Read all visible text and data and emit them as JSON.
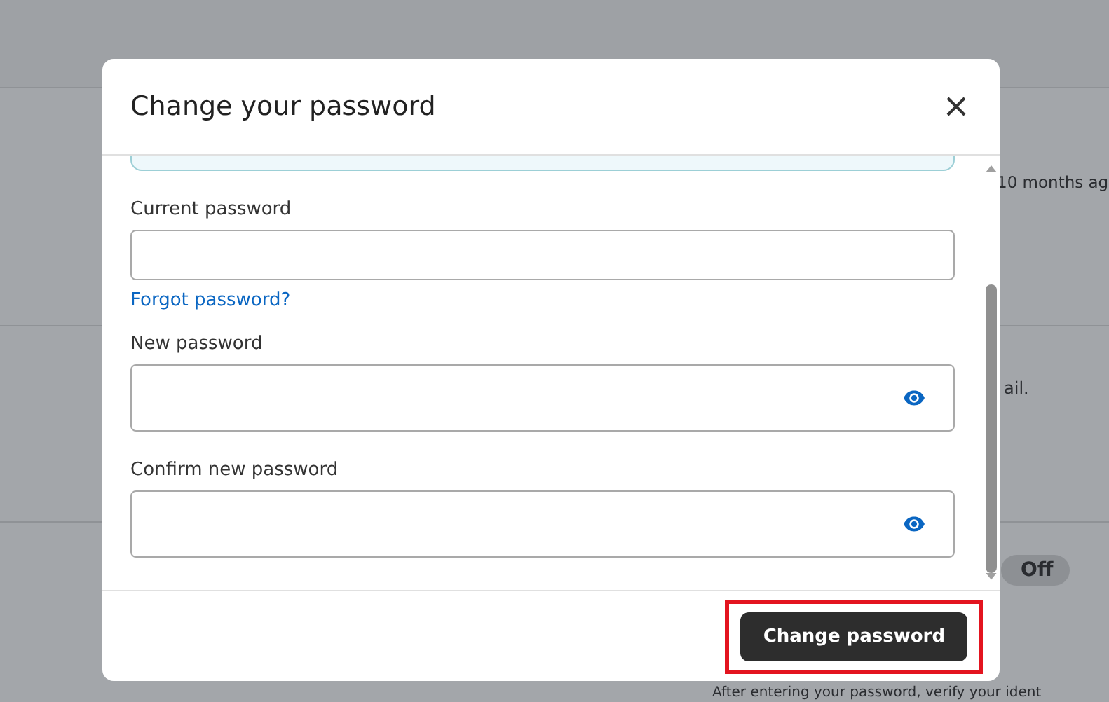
{
  "background": {
    "texts": [
      {
        "kind": "line",
        "text": "10 months ag"
      },
      {
        "kind": "line",
        "text": "ail."
      },
      {
        "kind": "pill",
        "text": "Off"
      },
      {
        "kind": "line",
        "text": "After entering your password, verify your ident"
      }
    ]
  },
  "dialog": {
    "title": "Change your password",
    "fields": [
      {
        "label": "Current password",
        "reveal": false,
        "link": "Forgot password?"
      },
      {
        "label": "New password",
        "reveal": true
      },
      {
        "label": "Confirm new password",
        "reveal": true
      }
    ],
    "button": {
      "label": "Change password",
      "highlighted": true
    }
  }
}
